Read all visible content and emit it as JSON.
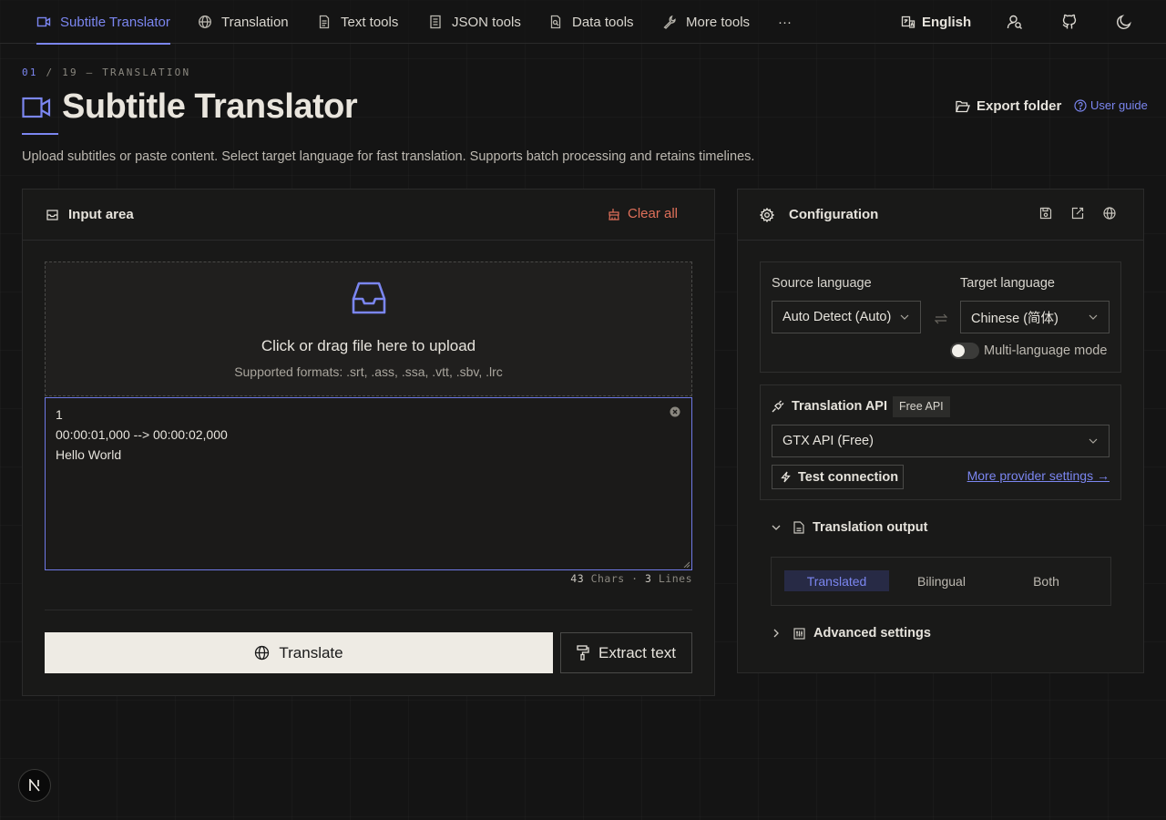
{
  "nav": {
    "items": [
      {
        "label": "Subtitle Translator",
        "icon": "video-icon"
      },
      {
        "label": "Translation",
        "icon": "globe-icon"
      },
      {
        "label": "Text tools",
        "icon": "file-text-icon"
      },
      {
        "label": "JSON tools",
        "icon": "json-icon"
      },
      {
        "label": "Data tools",
        "icon": "data-icon"
      },
      {
        "label": "More tools",
        "icon": "wrench-icon"
      }
    ],
    "more_label": "···",
    "language_label": "English"
  },
  "header": {
    "breadcrumb_num": "01",
    "breadcrumb_rest": " / 19 — TRANSLATION",
    "title": "Subtitle Translator",
    "description": "Upload subtitles or paste content. Select target language for fast translation. Supports batch processing and retains timelines.",
    "export_label": "Export folder",
    "guide_label": "User guide"
  },
  "input_panel": {
    "title": "Input area",
    "clear_label": "Clear all",
    "dropzone_title": "Click or drag file here to upload",
    "dropzone_formats": "Supported formats: .srt, .ass, .ssa, .vtt, .sbv, .lrc",
    "editor_lines": [
      "1",
      "00:00:01,000 --> 00:00:02,000",
      "Hello World"
    ],
    "char_count": "43",
    "chars_label": "Chars",
    "line_count": "3",
    "lines_label": "Lines",
    "translate_label": "Translate",
    "extract_label": "Extract text"
  },
  "config_panel": {
    "title": "Configuration",
    "source_label": "Source language",
    "source_value": "Auto Detect (Auto)",
    "target_label": "Target language",
    "target_value": "Chinese (简体)",
    "multi_lang_label": "Multi-language mode",
    "multi_lang_enabled": false,
    "api_title": "Translation API",
    "api_badge": "Free API",
    "api_value": "GTX API (Free)",
    "test_label": "Test connection",
    "provider_link": "More provider settings →",
    "output_title": "Translation output",
    "output_options": [
      "Translated",
      "Bilingual",
      "Both"
    ],
    "output_selected": "Translated",
    "advanced_title": "Advanced settings"
  },
  "colors": {
    "accent": "#7b86f0",
    "danger": "#e0705a",
    "background": "#141414",
    "panel": "#191918"
  }
}
